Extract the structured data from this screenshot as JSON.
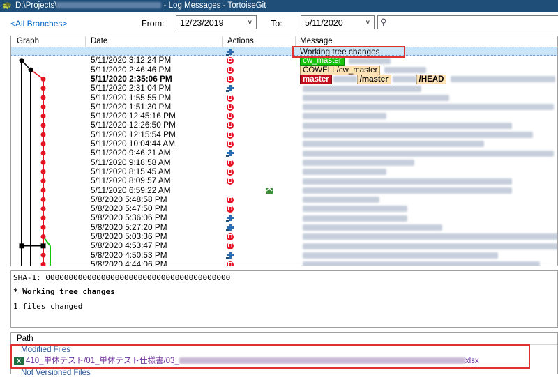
{
  "window": {
    "path_prefix": "D:\\Projects\\",
    "title_suffix": " - Log Messages - TortoiseGit"
  },
  "toolbar": {
    "branches_link": "<All Branches>",
    "from_label": "From:",
    "from_date": "12/23/2019",
    "to_label": "To:",
    "to_date": "5/11/2020",
    "search_placeholder": ""
  },
  "grid": {
    "columns": [
      "Graph",
      "Date",
      "Actions",
      "Message"
    ],
    "rows": [
      {
        "date": "",
        "action": "commit",
        "message": "Working tree changes",
        "selected": true
      },
      {
        "date": "5/11/2020 3:12:24 PM",
        "action": "modify",
        "tags": [
          {
            "text": "cw_master",
            "style": "green"
          }
        ]
      },
      {
        "date": "5/11/2020 2:46:46 PM",
        "action": "modify",
        "tags": [
          {
            "text": "COWELL/cw_master",
            "style": "tan"
          }
        ]
      },
      {
        "date": "5/11/2020 2:35:06 PM",
        "action": "modify",
        "bold": true,
        "tags": [
          {
            "text": "master",
            "style": "red"
          },
          {
            "text": "/master",
            "style": "head"
          },
          {
            "text": "/HEAD",
            "style": "head"
          }
        ]
      },
      {
        "date": "5/11/2020 2:31:04 PM",
        "action": "commit"
      },
      {
        "date": "5/11/2020 1:55:55 PM",
        "action": "modify"
      },
      {
        "date": "5/11/2020 1:51:30 PM",
        "action": "modify"
      },
      {
        "date": "5/11/2020 12:45:16 PM",
        "action": "modify"
      },
      {
        "date": "5/11/2020 12:26:50 PM",
        "action": "modify"
      },
      {
        "date": "5/11/2020 12:15:54 PM",
        "action": "modify"
      },
      {
        "date": "5/11/2020 10:04:44 AM",
        "action": "modify"
      },
      {
        "date": "5/11/2020 9:46:21 AM",
        "action": "commit"
      },
      {
        "date": "5/11/2020 9:18:58 AM",
        "action": "modify"
      },
      {
        "date": "5/11/2020 8:15:45 AM",
        "action": "modify"
      },
      {
        "date": "5/11/2020 8:09:57 AM",
        "action": "modify"
      },
      {
        "date": "5/11/2020 6:59:22 AM",
        "action": "rename"
      },
      {
        "date": "5/8/2020 5:48:58 PM",
        "action": "modify"
      },
      {
        "date": "5/8/2020 5:47:50 PM",
        "action": "modify"
      },
      {
        "date": "5/8/2020 5:36:06 PM",
        "action": "commit"
      },
      {
        "date": "5/8/2020 5:27:20 PM",
        "action": "commit"
      },
      {
        "date": "5/8/2020 5:03:36 PM",
        "action": "modify"
      },
      {
        "date": "5/8/2020 4:53:47 PM",
        "action": "modify"
      },
      {
        "date": "5/8/2020 4:50:53 PM",
        "action": "commit"
      },
      {
        "date": "5/8/2020 4:44:06 PM",
        "action": "modify"
      }
    ]
  },
  "details": {
    "sha_line": "SHA-1: 0000000000000000000000000000000000000000",
    "title_line": "* Working tree changes",
    "files_line": "1 files changed"
  },
  "files": {
    "header": "Path",
    "modified_group": "Modified Files",
    "file_path_start": "410_単体テスト/01_単体テスト仕様書/03_",
    "file_ext": "xlsx",
    "file_icon": "excel-icon",
    "unversioned_group": "Not Versioned Files"
  },
  "colors": {
    "titlebar": "#1f4e79",
    "highlight_box": "#e03131",
    "branch_red": "#e81123",
    "branch_green": "#16c60c",
    "link_blue": "#0066cc"
  }
}
